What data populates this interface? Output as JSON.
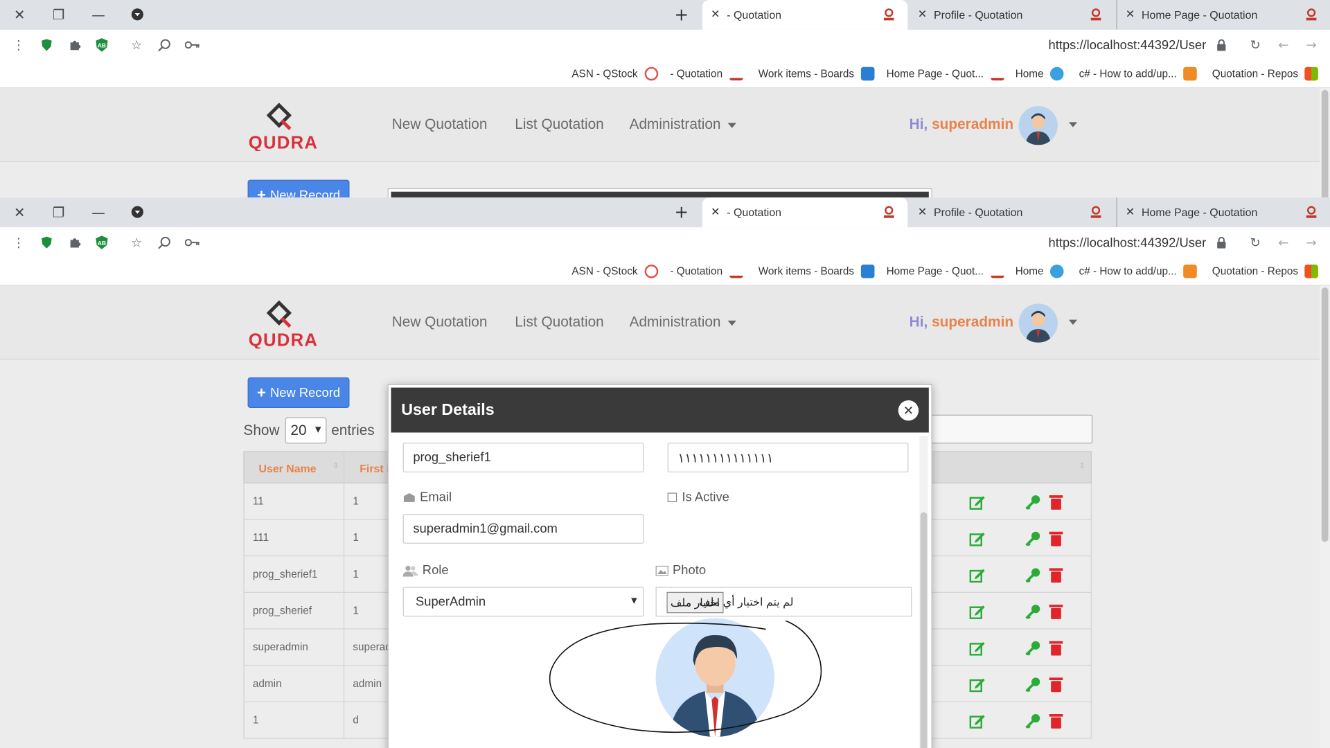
{
  "browser": {
    "tabs": [
      {
        "label": "- Quotation"
      },
      {
        "label": "Profile - Quotation"
      },
      {
        "label": "Home Page - Quotation"
      }
    ],
    "url": "https://localhost:44392/User",
    "bookmarks": [
      {
        "label": "ASN - QStock",
        "color": "#e05050"
      },
      {
        "label": "- Quotation",
        "color": "#c0392b"
      },
      {
        "label": "Work items - Boards",
        "color": "#2a7ed3"
      },
      {
        "label": "Home Page - Quot...",
        "color": "#c0392b"
      },
      {
        "label": "Home",
        "color": "#3aa0e0"
      },
      {
        "label": "c# - How to add/up...",
        "color": "#f08a24"
      },
      {
        "label": "Quotation - Repos",
        "color": "#f25022"
      }
    ]
  },
  "site": {
    "logo_text": "QUDRA",
    "nav": {
      "new_quotation": "New Quotation",
      "list_quotation": "List Quotation",
      "administration": "Administration"
    },
    "greeting": "Hi,",
    "username": "superadmin",
    "brand_color": "#d9313b",
    "accent_color": "#e8834a"
  },
  "page": {
    "new_record": "New Record",
    "show": "Show",
    "entries_value": "20",
    "entries": "entries",
    "table": {
      "headers": [
        "User Name",
        "First N"
      ],
      "rows": [
        [
          "11",
          "1"
        ],
        [
          "111",
          "1"
        ],
        [
          "prog_sherief1",
          "1"
        ],
        [
          "prog_sherief",
          "1"
        ],
        [
          "superadmin",
          "superad"
        ],
        [
          "admin",
          "admin"
        ],
        [
          "1",
          "d"
        ]
      ]
    }
  },
  "modal": {
    "title": "User Details",
    "username_value": "prog_sherief1",
    "phone_value": "١١١١١١١١١١١١١١",
    "email_label": "Email",
    "email_value": "superadmin1@gmail.com",
    "is_active_label": "Is Active",
    "role_label": "Role",
    "role_value": "SuperAdmin",
    "photo_label": "Photo",
    "file_button": "اختيار ملف",
    "file_status": "لم يتم اختيار أي ملف"
  }
}
